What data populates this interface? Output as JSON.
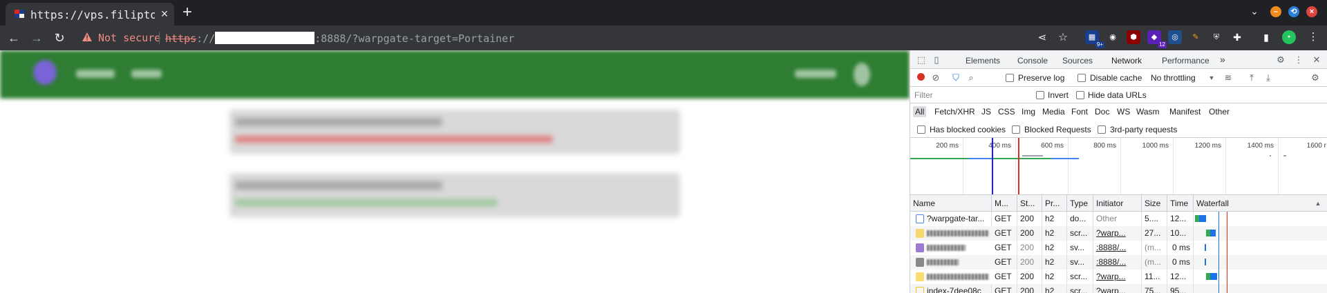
{
  "browser": {
    "tab_title": "https://vps.filipton",
    "new_tab_label": "+",
    "omnibox": {
      "security_label": "Not secure",
      "url_scheme": "https",
      "url_sep": "://",
      "url_rest": ":8888/?warpgate-target=Portainer"
    },
    "extension_badges": [
      "9+",
      "12"
    ]
  },
  "devtools": {
    "tabs": [
      "Elements",
      "Console",
      "Sources",
      "Network",
      "Performance",
      "»"
    ],
    "active_tab": "Network",
    "toolbar": {
      "preserve_log": "Preserve log",
      "disable_cache": "Disable cache",
      "throttling": "No throttling"
    },
    "filter": {
      "placeholder": "Filter",
      "invert": "Invert",
      "hide_data_urls": "Hide data URLs"
    },
    "type_filters": [
      "All",
      "Fetch/XHR",
      "JS",
      "CSS",
      "Img",
      "Media",
      "Font",
      "Doc",
      "WS",
      "Wasm",
      "Manifest",
      "Other"
    ],
    "checkbox_row": {
      "blocked_cookies": "Has blocked cookies",
      "blocked_requests": "Blocked Requests",
      "third_party": "3rd-party requests"
    },
    "overview_ticks": [
      "200 ms",
      "400 ms",
      "600 ms",
      "800 ms",
      "1000 ms",
      "1200 ms",
      "1400 ms",
      "1600 r"
    ],
    "columns": [
      "Name",
      "M...",
      "St...",
      "Pr...",
      "Type",
      "Initiator",
      "Size",
      "Time",
      "Waterfall"
    ],
    "rows": [
      {
        "name": "?warpgate-tar...",
        "method": "GET",
        "status": "200",
        "protocol": "h2",
        "type": "do...",
        "initiator": "Other",
        "size": "5....",
        "time": "12...",
        "icon": "doc-icon"
      },
      {
        "name": "",
        "method": "GET",
        "status": "200",
        "protocol": "h2",
        "type": "scr...",
        "initiator": "?warp...",
        "size": "27...",
        "time": "10...",
        "icon": "script-icon"
      },
      {
        "name": "",
        "method": "GET",
        "status": "200",
        "protocol": "h2",
        "type": "sv...",
        "initiator": ":8888/...",
        "size": "(m...",
        "time": "0 ms",
        "icon": "svg-icon"
      },
      {
        "name": "",
        "method": "GET",
        "status": "200",
        "protocol": "h2",
        "type": "sv...",
        "initiator": ":8888/...",
        "size": "(m...",
        "time": "0 ms",
        "icon": "svg-icon"
      },
      {
        "name": "",
        "method": "GET",
        "status": "200",
        "protocol": "h2",
        "type": "scr...",
        "initiator": "?warp...",
        "size": "11...",
        "time": "12...",
        "icon": "script-icon"
      },
      {
        "name": "index-7dee08c",
        "method": "GET",
        "status": "200",
        "protocol": "h2",
        "type": "scr...",
        "initiator": "?warp...",
        "size": "75...",
        "time": "95...",
        "icon": "script-icon"
      }
    ]
  }
}
